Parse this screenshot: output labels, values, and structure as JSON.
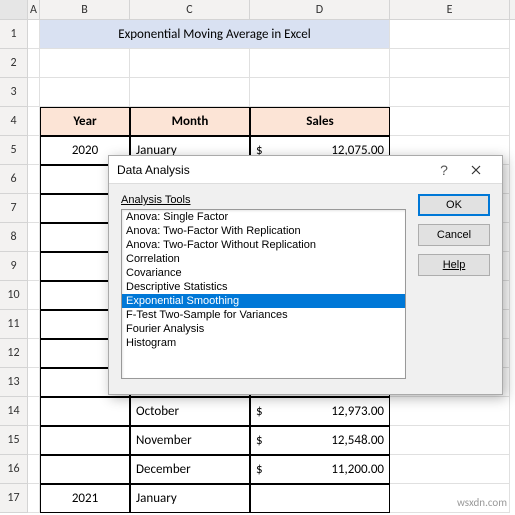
{
  "columns": [
    "A",
    "B",
    "C",
    "D",
    "E"
  ],
  "rows": [
    "1",
    "2",
    "3",
    "4",
    "5",
    "6",
    "7",
    "8",
    "9",
    "10",
    "11",
    "12",
    "13",
    "14",
    "15",
    "16",
    "17"
  ],
  "title": "Exponential Moving Average in Excel",
  "table": {
    "headers": {
      "year": "Year",
      "month": "Month",
      "sales": "Sales"
    },
    "rows": [
      {
        "year": "2020",
        "month": "January",
        "sales": "12,075.00"
      },
      {
        "year": "",
        "month": "",
        "sales": ""
      },
      {
        "year": "",
        "month": "",
        "sales": ""
      },
      {
        "year": "",
        "month": "",
        "sales": ""
      },
      {
        "year": "",
        "month": "",
        "sales": ""
      },
      {
        "year": "",
        "month": "",
        "sales": ""
      },
      {
        "year": "",
        "month": "",
        "sales": ""
      },
      {
        "year": "",
        "month": "",
        "sales": ""
      },
      {
        "year": "",
        "month": "",
        "sales": ""
      },
      {
        "year": "",
        "month": "October",
        "sales": "12,973.00"
      },
      {
        "year": "",
        "month": "November",
        "sales": "12,548.00"
      },
      {
        "year": "",
        "month": "December",
        "sales": "11,200.00"
      },
      {
        "year": "2021",
        "month": "January",
        "sales": ""
      }
    ]
  },
  "currencySymbol": "$",
  "dialog": {
    "title": "Data Analysis",
    "label": "Analysis Tools",
    "helpIcon": "?",
    "items": [
      "Anova: Single Factor",
      "Anova: Two-Factor With Replication",
      "Anova: Two-Factor Without Replication",
      "Correlation",
      "Covariance",
      "Descriptive Statistics",
      "Exponential Smoothing",
      "F-Test Two-Sample for Variances",
      "Fourier Analysis",
      "Histogram"
    ],
    "selectedIndex": 6,
    "buttons": {
      "ok": "OK",
      "cancel": "Cancel",
      "help": "Help"
    }
  },
  "watermark": "wsxdn.com"
}
